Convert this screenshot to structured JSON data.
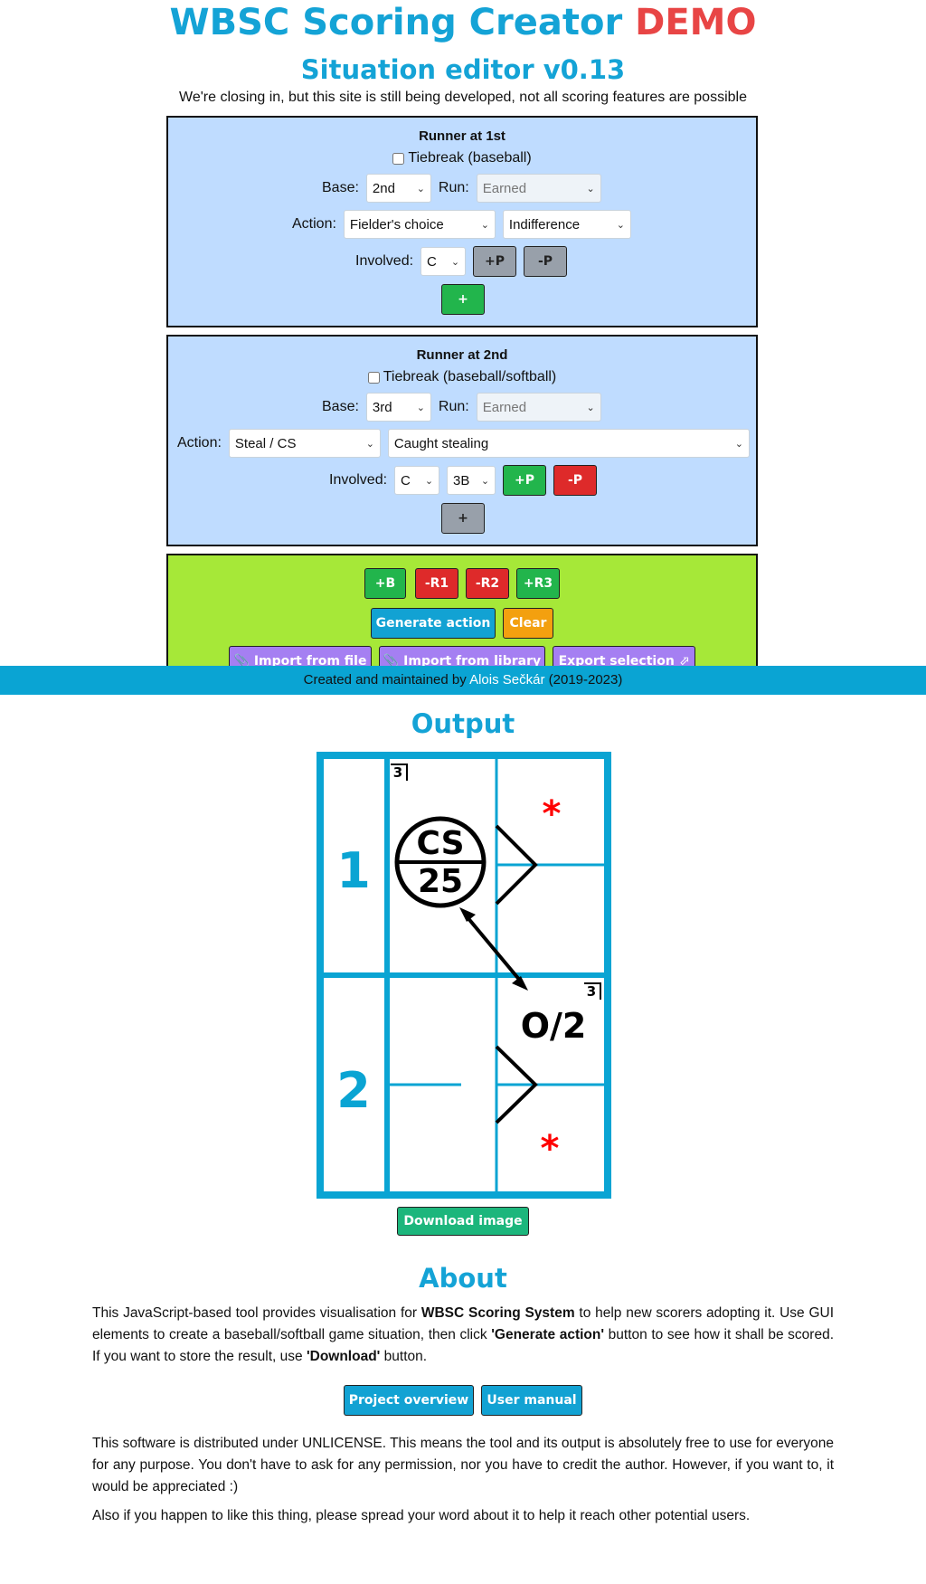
{
  "header": {
    "title": "WBSC Scoring Creator",
    "title_demo": "DEMO",
    "subtitle": "Situation editor v0.13",
    "notice": "We're closing in, but this site is still being developed, not all scoring features are possible"
  },
  "runner1": {
    "title": "Runner at 1st",
    "tiebreak_label": "Tiebreak (baseball)",
    "base_label": "Base:",
    "base_value": "2nd",
    "run_label": "Run:",
    "run_value": "Earned",
    "action_label": "Action:",
    "action_value": "Fielder's choice",
    "action_detail": "Indifference",
    "involved_label": "Involved:",
    "involved_values": [
      "C"
    ],
    "add_player": "+P",
    "remove_player": "-P",
    "add_action": "+"
  },
  "runner2": {
    "title": "Runner at 2nd",
    "tiebreak_label": "Tiebreak (baseball/softball)",
    "base_label": "Base:",
    "base_value": "3rd",
    "run_label": "Run:",
    "run_value": "Earned",
    "action_label": "Action:",
    "action_value": "Steal / CS",
    "action_detail": "Caught stealing",
    "involved_label": "Involved:",
    "involved_values": [
      "C",
      "3B"
    ],
    "add_player": "+P",
    "remove_player": "-P",
    "add_action": "+"
  },
  "controls": {
    "add_batter": "+B",
    "remove_r1": "-R1",
    "remove_r2": "-R2",
    "add_r3": "+R3",
    "generate": "Generate action",
    "clear": "Clear",
    "import_file": "📎 Import from file",
    "import_library": "📎 Import from library",
    "export": "Export selection ⬀"
  },
  "footer": {
    "prefix": "Created and maintained by",
    "author": "Alois Sečkár",
    "years": "(2019-2023)"
  },
  "output": {
    "title": "Output",
    "rows": [
      {
        "number": "1",
        "badge": "3",
        "circle_top": "CS",
        "circle_bottom": "25"
      },
      {
        "number": "2",
        "badge": "3",
        "out_text": "O/2"
      }
    ],
    "download": "Download image"
  },
  "about": {
    "title": "About",
    "p1_a": "This JavaScript-based tool provides visualisation for",
    "p1_b": "WBSC Scoring System",
    "p1_c": "to help new scorers adopting it. Use GUI elements to create a baseball/softball game situation, then click",
    "p1_d": "'Generate action'",
    "p1_e": "button to see how it shall be scored. If you want to store the result, use",
    "p1_f": "'Download'",
    "p1_g": "button.",
    "project_overview": "Project overview",
    "user_manual": "User manual",
    "p2": "This software is distributed under UNLICENSE. This means the tool and its output is absolutely free to use for everyone for any purpose. You don't have to ask for any permission, nor you have to credit the author. However, if you want to, it would be appreciated :)",
    "p3": "Also if you happen to like this thing, please spread your word about it to help it reach other potential users."
  },
  "colors": {
    "accent": "#14a3d6",
    "demo": "#e84545",
    "panel_blue": "#bfdcff",
    "panel_green": "#a6e838",
    "star": "#ff0000"
  }
}
